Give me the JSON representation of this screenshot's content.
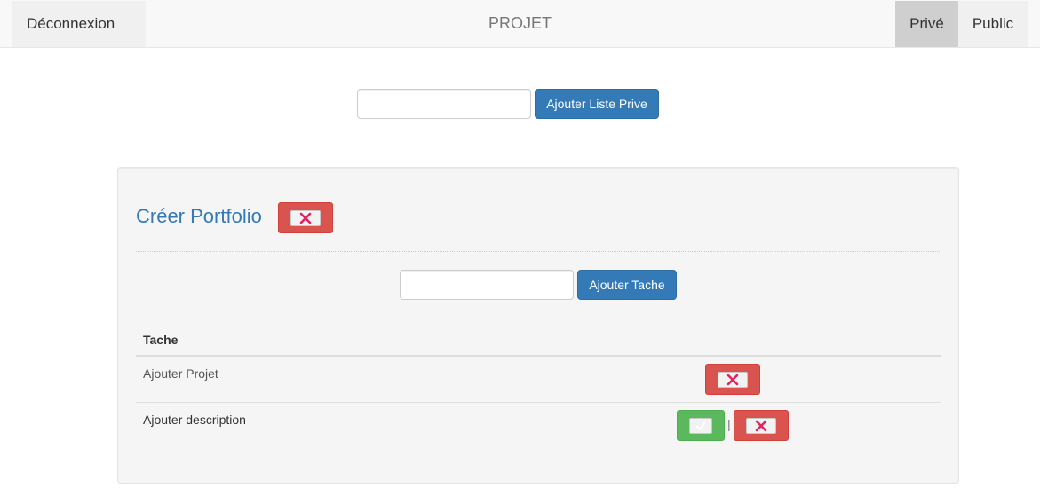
{
  "navbar": {
    "logout_label": "Déconnexion",
    "brand": "PROJET",
    "tabs": [
      {
        "label": "Privé",
        "active": true
      },
      {
        "label": "Public",
        "active": false
      }
    ]
  },
  "add_list": {
    "input_value": "",
    "button_label": "Ajouter Liste Prive"
  },
  "list": {
    "title": "Créer Portfolio",
    "add_task": {
      "input_value": "",
      "button_label": "Ajouter Tache"
    },
    "table": {
      "header": "Tache",
      "rows": [
        {
          "task": "Ajouter Projet",
          "completed": true,
          "actions": [
            "delete-icon"
          ]
        },
        {
          "task": "Ajouter description",
          "completed": false,
          "actions": [
            "check-icon",
            "delete-icon"
          ],
          "separator": "|"
        }
      ]
    }
  },
  "colors": {
    "primary": "#337ab7",
    "danger": "#d9534f",
    "success": "#5cb85c",
    "cross": "#e0245e"
  }
}
